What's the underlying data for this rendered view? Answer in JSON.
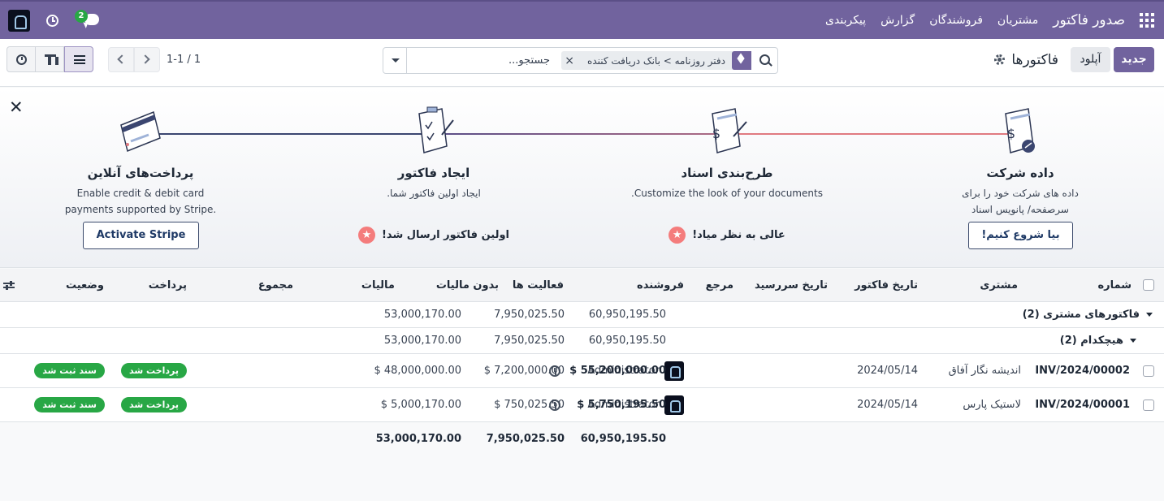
{
  "navbar": {
    "app_name": "صدور فاکتور",
    "menu": [
      "مشتریان",
      "فروشندگان",
      "گزارش",
      "پیکربندی"
    ],
    "chat_count": "2"
  },
  "control": {
    "new_button": "جدید",
    "upload_button": "آپلود",
    "title": "فاکتورها",
    "search_facet": "دفتر روزنامه > بانک دریافت کننده",
    "search_placeholder": "جستجو...",
    "pager": "1-1 / 1"
  },
  "onboarding": {
    "steps": [
      {
        "title": "داده شرکت",
        "desc": "داده های شرکت خود را برای سرصفحه/ پانویس اسناد تنظیم کنید.",
        "button": "بیا شروع کنیم!"
      },
      {
        "title": "طرح‌بندی اسناد",
        "desc": "Customize the look of your documents.",
        "done": "عالی به نظر میاد!"
      },
      {
        "title": "ایجاد فاکتور",
        "desc": "ایجاد اولین فاکتور شما.",
        "done": "اولین فاکتور ارسال شد!"
      },
      {
        "title": "پرداخت‌های آنلاین",
        "desc": "Enable credit & debit card payments supported by Stripe.",
        "button": "Activate Stripe"
      }
    ]
  },
  "table": {
    "headers": {
      "number": "شماره",
      "customer": "مشتری",
      "invoice_date": "تاریخ فاکتور",
      "due_date": "تاریخ سررسید",
      "reference": "مرجع",
      "salesperson": "فروشنده",
      "activities": "فعالیت ها",
      "untaxed": "بدون مالیات",
      "tax": "مالیات",
      "total": "مجموع",
      "payment": "پرداخت",
      "status": "وضعیت"
    },
    "group1": {
      "label": "فاکتورهای مشتری (2)",
      "untaxed": "53,000,170.00",
      "tax": "7,950,025.50",
      "total": "60,950,195.50"
    },
    "group2": {
      "label": "هیچکدام (2)",
      "untaxed": "53,000,170.00",
      "tax": "7,950,025.50",
      "total": "60,950,195.50"
    },
    "rows": [
      {
        "number": "INV/2024/00002",
        "customer": "اندیشه نگار آفاق",
        "invoice_date": "2024/05/14",
        "salesperson": "Administrator",
        "untaxed": "$ 48,000,000.00",
        "tax": "$ 7,200,000.00",
        "total": "$ 55,200,000.00",
        "payment": "پرداخت شد",
        "status": "سند ثبت شد"
      },
      {
        "number": "INV/2024/00001",
        "customer": "لاستیک پارس",
        "invoice_date": "2024/05/14",
        "salesperson": "Administrator",
        "untaxed": "$ 5,000,170.00",
        "tax": "$ 750,025.50",
        "total": "$ 5,750,195.50",
        "payment": "پرداخت شد",
        "status": "سند ثبت شد"
      }
    ],
    "totals": {
      "untaxed": "53,000,170.00",
      "tax": "7,950,025.50",
      "total": "60,950,195.50"
    }
  },
  "colors": {
    "brand": "#71639e",
    "success": "#28a745",
    "accent_red": "#f47c7c"
  }
}
